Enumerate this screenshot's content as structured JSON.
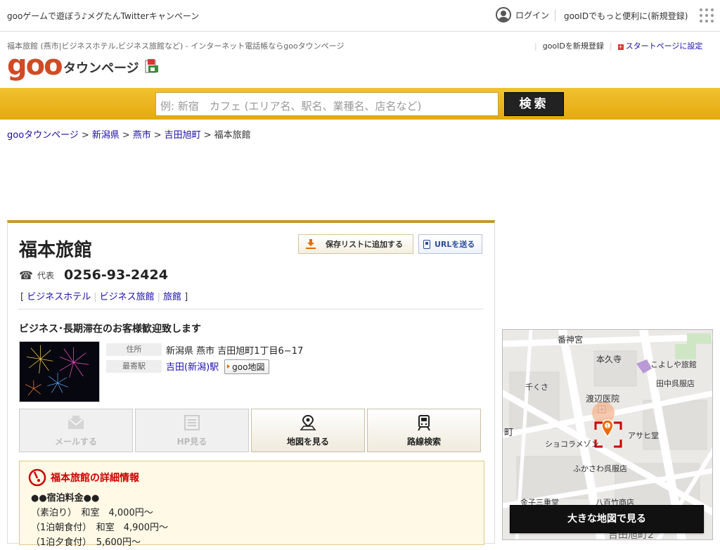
{
  "topbar": {
    "campaign": "gooゲームで遊ぼう♪メグたんTwitterキャンペーン",
    "login": "ログイン",
    "register": "gooIDでもっと便利に(新規登録)"
  },
  "header": {
    "subline": "福本旅館 (燕市|ビジネスホテル,ビジネス旅館など) - インターネット電話帳ならgooタウンページ",
    "register_link": "gooIDを新規登録",
    "start_link": "スタートページに設定",
    "logo": "goo",
    "logo_sub": "タウンページ"
  },
  "search": {
    "placeholder": "例: 新宿　カフェ (エリア名、駅名、業種名、店名など)",
    "button": "検索"
  },
  "breadcrumb": {
    "items": [
      "gooタウンページ",
      "新潟県",
      "燕市",
      "吉田旭町"
    ],
    "current": "福本旅館"
  },
  "listing": {
    "name": "福本旅館",
    "save_button": "保存リストに追加する",
    "url_button": "URLを送る",
    "tel_label": "代表",
    "tel": "0256-93-2424",
    "categories": [
      "ビジネスホテル",
      "ビジネス旅館",
      "旅館"
    ],
    "catchphrase": "ビジネス･長期滞在のお客様歓迎致します",
    "address_label": "住所",
    "address": "新潟県 燕市 吉田旭町1丁目6−17",
    "station_label": "最寄駅",
    "station": "吉田(新潟)駅",
    "goo_map": "goo地図",
    "actions": {
      "mail": "メールする",
      "hp": "HP見る",
      "map": "地図を見る",
      "route": "路線検索"
    }
  },
  "detail": {
    "title": "福本旅館の詳細情報",
    "lines": [
      "●●宿泊料金●●",
      "（素泊り）　和室　4,000円～",
      "（1泊朝食付）　和室　4,900円～",
      "（1泊夕食付）　5,600円～"
    ]
  },
  "map": {
    "labels": [
      "番神宮",
      "本久寺",
      "こよしや旅館",
      "田中呉服店",
      "千くさ",
      "渡辺医院",
      "アサヒ堂",
      "ショコラメゾン",
      "ふかさわ呉服店",
      "金子三重堂",
      "八百竹商店",
      "吉田旭町2",
      "町"
    ],
    "pin": "1",
    "button": "大きな地図で見る"
  },
  "colors": {
    "brand": "#d24a25",
    "band": "#f1c230",
    "detail_title": "#cc0000"
  }
}
